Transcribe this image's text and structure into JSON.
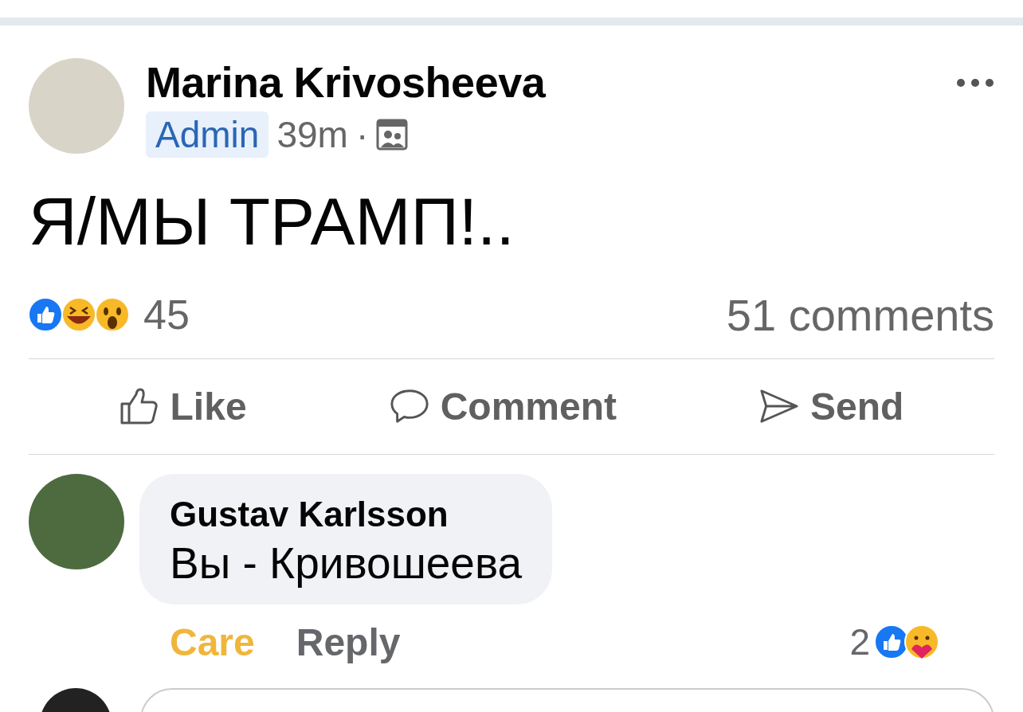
{
  "post": {
    "author": "Marina Krivosheeva",
    "badge": "Admin",
    "time": "39m",
    "separator": "·",
    "text": "Я/МЫ ТРАМП!..",
    "reaction_count": "45",
    "comments_count": "51 comments",
    "actions": [
      {
        "label": "Like",
        "kind": "like"
      },
      {
        "label": "Comment",
        "kind": "comment"
      },
      {
        "label": "Send",
        "kind": "send"
      }
    ]
  },
  "comments": [
    {
      "author": "Gustav Karlsson",
      "text": "Вы - Кривошеева",
      "actions": [
        {
          "label": "Care",
          "selected": true
        },
        {
          "label": "Reply",
          "selected": false
        }
      ],
      "reaction_count": "2"
    }
  ]
}
